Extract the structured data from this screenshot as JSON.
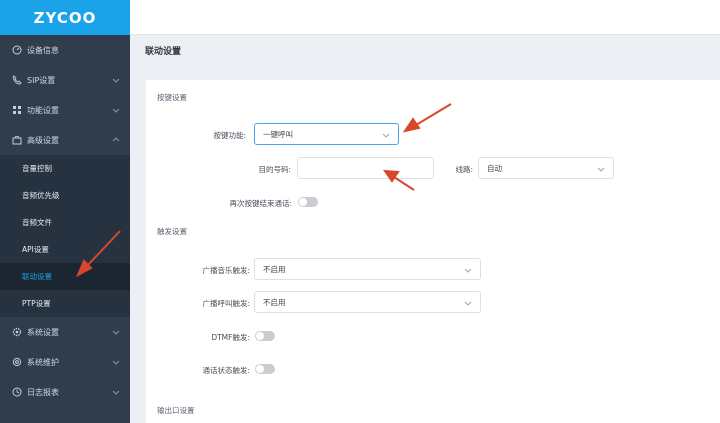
{
  "app": {
    "logo_text": "ZYCOO"
  },
  "sidebar": {
    "items": [
      {
        "label": "设备信息",
        "icon": "gauge-icon"
      },
      {
        "label": "SIP设置",
        "icon": "phone-icon"
      },
      {
        "label": "功能设置",
        "icon": "grid-icon"
      },
      {
        "label": "高级设置",
        "icon": "briefcase-icon"
      }
    ],
    "submenu": [
      {
        "label": "音量控制"
      },
      {
        "label": "音频优先级"
      },
      {
        "label": "音频文件"
      },
      {
        "label": "API设置"
      },
      {
        "label": "联动设置"
      },
      {
        "label": "PTP设置"
      }
    ],
    "bottom_items": [
      {
        "label": "系统设置",
        "icon": "gear-icon"
      },
      {
        "label": "系统维护",
        "icon": "wrench-icon"
      },
      {
        "label": "日志报表",
        "icon": "clock-icon"
      }
    ]
  },
  "page": {
    "title": "联动设置"
  },
  "sections": {
    "key": {
      "title": "按键设置",
      "function_label": "按键功能:",
      "function_value": "一键呼叫",
      "target_label": "目的号码:",
      "target_value": "",
      "line_label": "线路:",
      "line_value": "自动",
      "end_call_label": "再次按键结束通话:"
    },
    "trigger": {
      "title": "触发设置",
      "music_label": "广播音乐触发:",
      "music_value": "不启用",
      "call_label": "广播呼叫触发:",
      "call_value": "不启用",
      "dtmf_label": "DTMF触发:",
      "status_label": "通话状态触发:"
    },
    "output": {
      "title": "输出口设置"
    }
  },
  "colors": {
    "accent": "#1aa3e8",
    "sidebar": "#2f3d4c",
    "annotation": "#d9472b"
  }
}
